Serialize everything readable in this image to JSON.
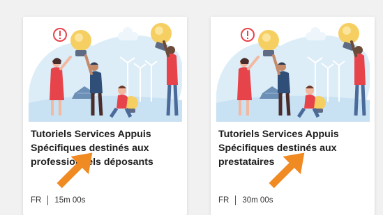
{
  "cards": [
    {
      "title_lines": [
        "Tutoriels Services Appuis",
        "Spécifiques destinés aux",
        "professionnels déposants"
      ],
      "language": "FR",
      "duration": "15m 00s"
    },
    {
      "title_lines": [
        "Tutoriels Services Appuis",
        "Spécifiques destinés aux",
        "prestataires"
      ],
      "language": "FR",
      "duration": "30m 00s"
    }
  ],
  "colors": {
    "page_background": "#f1f1f1",
    "card_background": "#ffffff",
    "illustration_sky": "#dcedf8",
    "bulb": "#f6cf62",
    "arrow": "#f08a23",
    "title_text": "#1e1e1e"
  },
  "icons": {
    "illustration": "people-with-lightbulbs-illustration",
    "annotation": "orange-arrow-pointing-up-right"
  }
}
